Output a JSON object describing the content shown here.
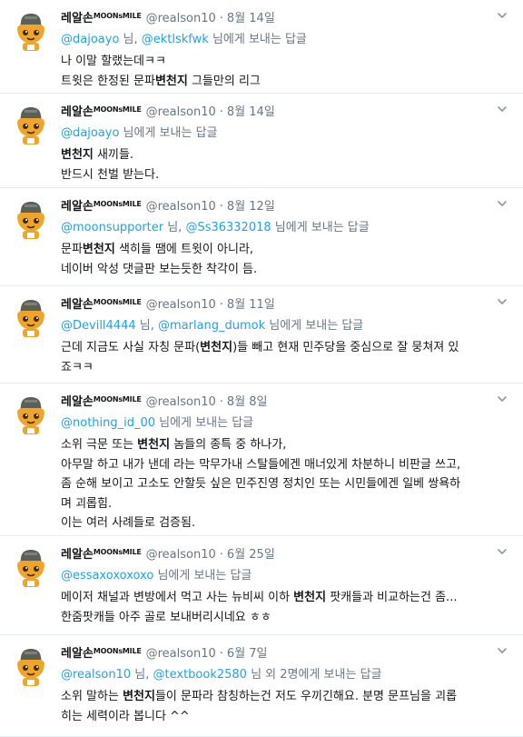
{
  "colors": {
    "link": "#1da1f2",
    "muted": "#657786",
    "text": "#14171a",
    "divider": "#e6ecf0"
  },
  "icons": {
    "avatar": "character-avatar",
    "menu": "chevron-down-icon"
  },
  "tweets": [
    {
      "name": "레알손",
      "badge": "MOONsMILE",
      "handle": "@realson10",
      "dot": "·",
      "date": "8월 14일",
      "reply_mentions": [
        "@dajoayo",
        "@ektlskfwk"
      ],
      "reply_prefix": "",
      "reply_sep": " 님, ",
      "reply_suffix": " 님에게 보내는 답글",
      "lines": [
        [
          {
            "t": "나 이말 할랬는데ㅋㅋ"
          }
        ],
        [
          {
            "t": "트윗은 한정된 문파"
          },
          {
            "t": "변천지",
            "b": true
          },
          {
            "t": " 그들만의 리그"
          }
        ]
      ]
    },
    {
      "name": "레알손",
      "badge": "MOONsMILE",
      "handle": "@realson10",
      "dot": "·",
      "date": "8월 14일",
      "reply_mentions": [
        "@dajoayo"
      ],
      "reply_sep": "",
      "reply_suffix": " 님에게 보내는 답글",
      "lines": [
        [
          {
            "t": "변천지",
            "b": true
          },
          {
            "t": " 새끼들."
          }
        ],
        [
          {
            "t": "반드시 천벌 받는다."
          }
        ]
      ]
    },
    {
      "name": "레알손",
      "badge": "MOONsMILE",
      "handle": "@realson10",
      "dot": "·",
      "date": "8월 12일",
      "reply_mentions": [
        "@moonsupporter",
        "@Ss36332018"
      ],
      "reply_sep": " 님, ",
      "reply_suffix": " 님에게 보내는 답글",
      "lines": [
        [
          {
            "t": "문파"
          },
          {
            "t": "변천지",
            "b": true
          },
          {
            "t": " 색히들 땜에 트윗이 아니라,"
          }
        ],
        [
          {
            "t": "네이버 악성 댓글판 보는듯한 착각이 듬."
          }
        ]
      ]
    },
    {
      "name": "레알손",
      "badge": "MOONsMILE",
      "handle": "@realson10",
      "dot": "·",
      "date": "8월 11일",
      "reply_mentions": [
        "@Devill4444",
        "@marlang_dumok"
      ],
      "reply_sep": " 님, ",
      "reply_suffix": " 님에게 보내는 답글",
      "lines": [
        [
          {
            "t": "근데 지금도 사실 자칭 문파("
          },
          {
            "t": "변천지",
            "b": true
          },
          {
            "t": ")들 빼고 현재 민주당을 중심으로 잘 뭉쳐져 있"
          }
        ],
        [
          {
            "t": "죠ㅋㅋ"
          }
        ]
      ]
    },
    {
      "name": "레알손",
      "badge": "MOONsMILE",
      "handle": "@realson10",
      "dot": "·",
      "date": "8월 8일",
      "reply_mentions": [
        "@nothing_id_00"
      ],
      "reply_sep": "",
      "reply_suffix": " 님에게 보내는 답글",
      "lines": [
        [
          {
            "t": "소위 극문 또는 "
          },
          {
            "t": "변천지",
            "b": true
          },
          {
            "t": " 놈들의 종특 중 하나가,"
          }
        ],
        [
          {
            "t": "아무말 하고 내가 낸데 라는 막무가내 스탈들에겐 매너있게 차분하니 비판글 쓰고,"
          }
        ],
        [
          {
            "t": "좀 순해 보이고 고소도 안할듯 싶은 민주진영 정치인 또는 시민들에겐 일베 쌍욕하"
          }
        ],
        [
          {
            "t": "며 괴롭힘."
          }
        ],
        [
          {
            "t": "이는 여러 사례들로 검증됨."
          }
        ]
      ]
    },
    {
      "name": "레알손",
      "badge": "MOONsMILE",
      "handle": "@realson10",
      "dot": "·",
      "date": "6월 25일",
      "reply_mentions": [
        "@essaxoxoxoxo"
      ],
      "reply_sep": "",
      "reply_suffix": " 님에게 보내는 답글",
      "lines": [
        [
          {
            "t": "메이저 채널과 변방에서 먹고 사는 뉴비씨 이하 "
          },
          {
            "t": "변천지",
            "b": true
          },
          {
            "t": " 팟캐들과 비교하는건 좀..."
          }
        ],
        [
          {
            "t": "한줌팟캐들 아주 골로 보내버리시네요 ㅎㅎ"
          }
        ]
      ]
    },
    {
      "name": "레알손",
      "badge": "MOONsMILE",
      "handle": "@realson10",
      "dot": "·",
      "date": "6월 7일",
      "reply_mentions": [
        "@realson10",
        "@textbook2580"
      ],
      "reply_sep": " 님, ",
      "reply_suffix": " 님 외 2명에게 보내는 답글",
      "lines": [
        [
          {
            "t": "소위 말하는 "
          },
          {
            "t": "변천지",
            "b": true
          },
          {
            "t": "들이 문파라 참칭하는건 저도 우끼긴해요. 분명 문프님을 괴롭"
          }
        ],
        [
          {
            "t": "히는 세력이라 봅니다 ^^"
          }
        ]
      ]
    }
  ]
}
